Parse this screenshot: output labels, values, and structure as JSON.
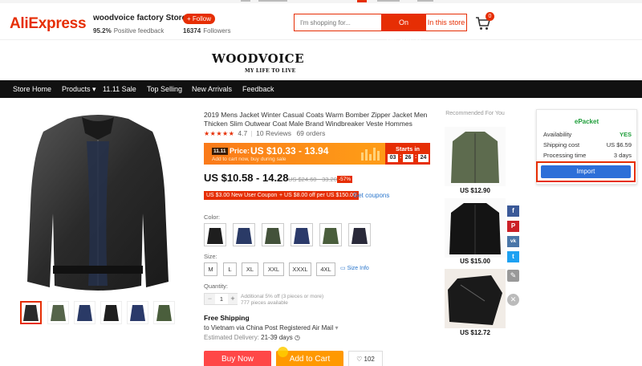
{
  "header": {
    "logo": "AliExpress",
    "store_name": "woodvoice factory Store",
    "positive_feedback_pct": "95.2%",
    "positive_feedback_label": "Positive feedback",
    "follow_label": "+ Follow",
    "followers_count": "16374",
    "followers_label": "Followers",
    "search_placeholder": "I'm shopping for...",
    "search_aliexpress": "On AliExpress",
    "search_store": "In this store",
    "cart_count": "0"
  },
  "banner": {
    "title": "WOODVOICE",
    "subtitle": "MY LIFE TO LIVE"
  },
  "nav": {
    "items": [
      "Store Home",
      "Products",
      "11.11 Sale",
      "Top Selling",
      "New Arrivals",
      "Feedback"
    ]
  },
  "product": {
    "title": "2019 Mens Jacket Winter Casual Coats Warm Bomber Zipper Jacket Men Thicken Slim Outwear Coat Male Brand Windbreaker Veste Hommes",
    "stars": "★★★★★",
    "rating": "4.7",
    "reviews": "10 Reviews",
    "orders": "69 orders",
    "sale_badge": "11.11",
    "sale_price_label": "Price:",
    "sale_price": "US $10.33 - 13.94",
    "sale_note": "Add to cart now, buy during sale",
    "countdown_label": "Starts in",
    "countdown": [
      "03",
      "26",
      "24"
    ],
    "price": "US $10.58 - 14.28",
    "old_price": "US $24.60 - 33.20",
    "discount": "-57%",
    "coupons": [
      "US $3.00 New User Coupon",
      "+ US $8.00 off per US $150.00"
    ],
    "get_coupons": "Get coupons",
    "color_label": "Color:",
    "color_swatches": [
      "#1e1e1e",
      "#2a3a66",
      "#43523a",
      "#2b3a6a",
      "#4a5e3c",
      "#2a2a3a"
    ],
    "size_label": "Size:",
    "sizes": [
      "M",
      "L",
      "XL",
      "XXL",
      "XXXL",
      "4XL"
    ],
    "size_info": "Size Info",
    "quantity_label": "Quantity:",
    "quantity": "1",
    "qty_note1": "Additional 5% off (3 pieces or more)",
    "qty_note2": "777 pieces available",
    "free_shipping": "Free Shipping",
    "ship_to": "to Vietnam via China Post Registered Air Mail",
    "estimated_label": "Estimated Delivery:",
    "estimated_days": "21-39 days",
    "buy_now": "Buy Now",
    "add_to_cart": "Add to Cart",
    "wishlist_count": "102"
  },
  "recommended": {
    "title": "Recommended For You",
    "items": [
      {
        "price": "US $12.90",
        "color": "#5d6b4e"
      },
      {
        "price": "US $15.00",
        "color": "#141414"
      },
      {
        "price": "US $12.72",
        "color": "#1a1a1a"
      }
    ]
  },
  "share": {
    "icons": [
      "f",
      "P",
      "vk",
      "t"
    ],
    "colors": [
      "#3b5998",
      "#cb2027",
      "#4a76a8",
      "#1da1f2"
    ]
  },
  "epacket": {
    "title": "ePacket",
    "availability_label": "Availability",
    "availability_value": "YES",
    "shipping_cost_label": "Shipping cost",
    "shipping_cost_value": "US $6.59",
    "processing_label": "Processing time",
    "processing_value": "3 days",
    "import_label": "Import"
  }
}
